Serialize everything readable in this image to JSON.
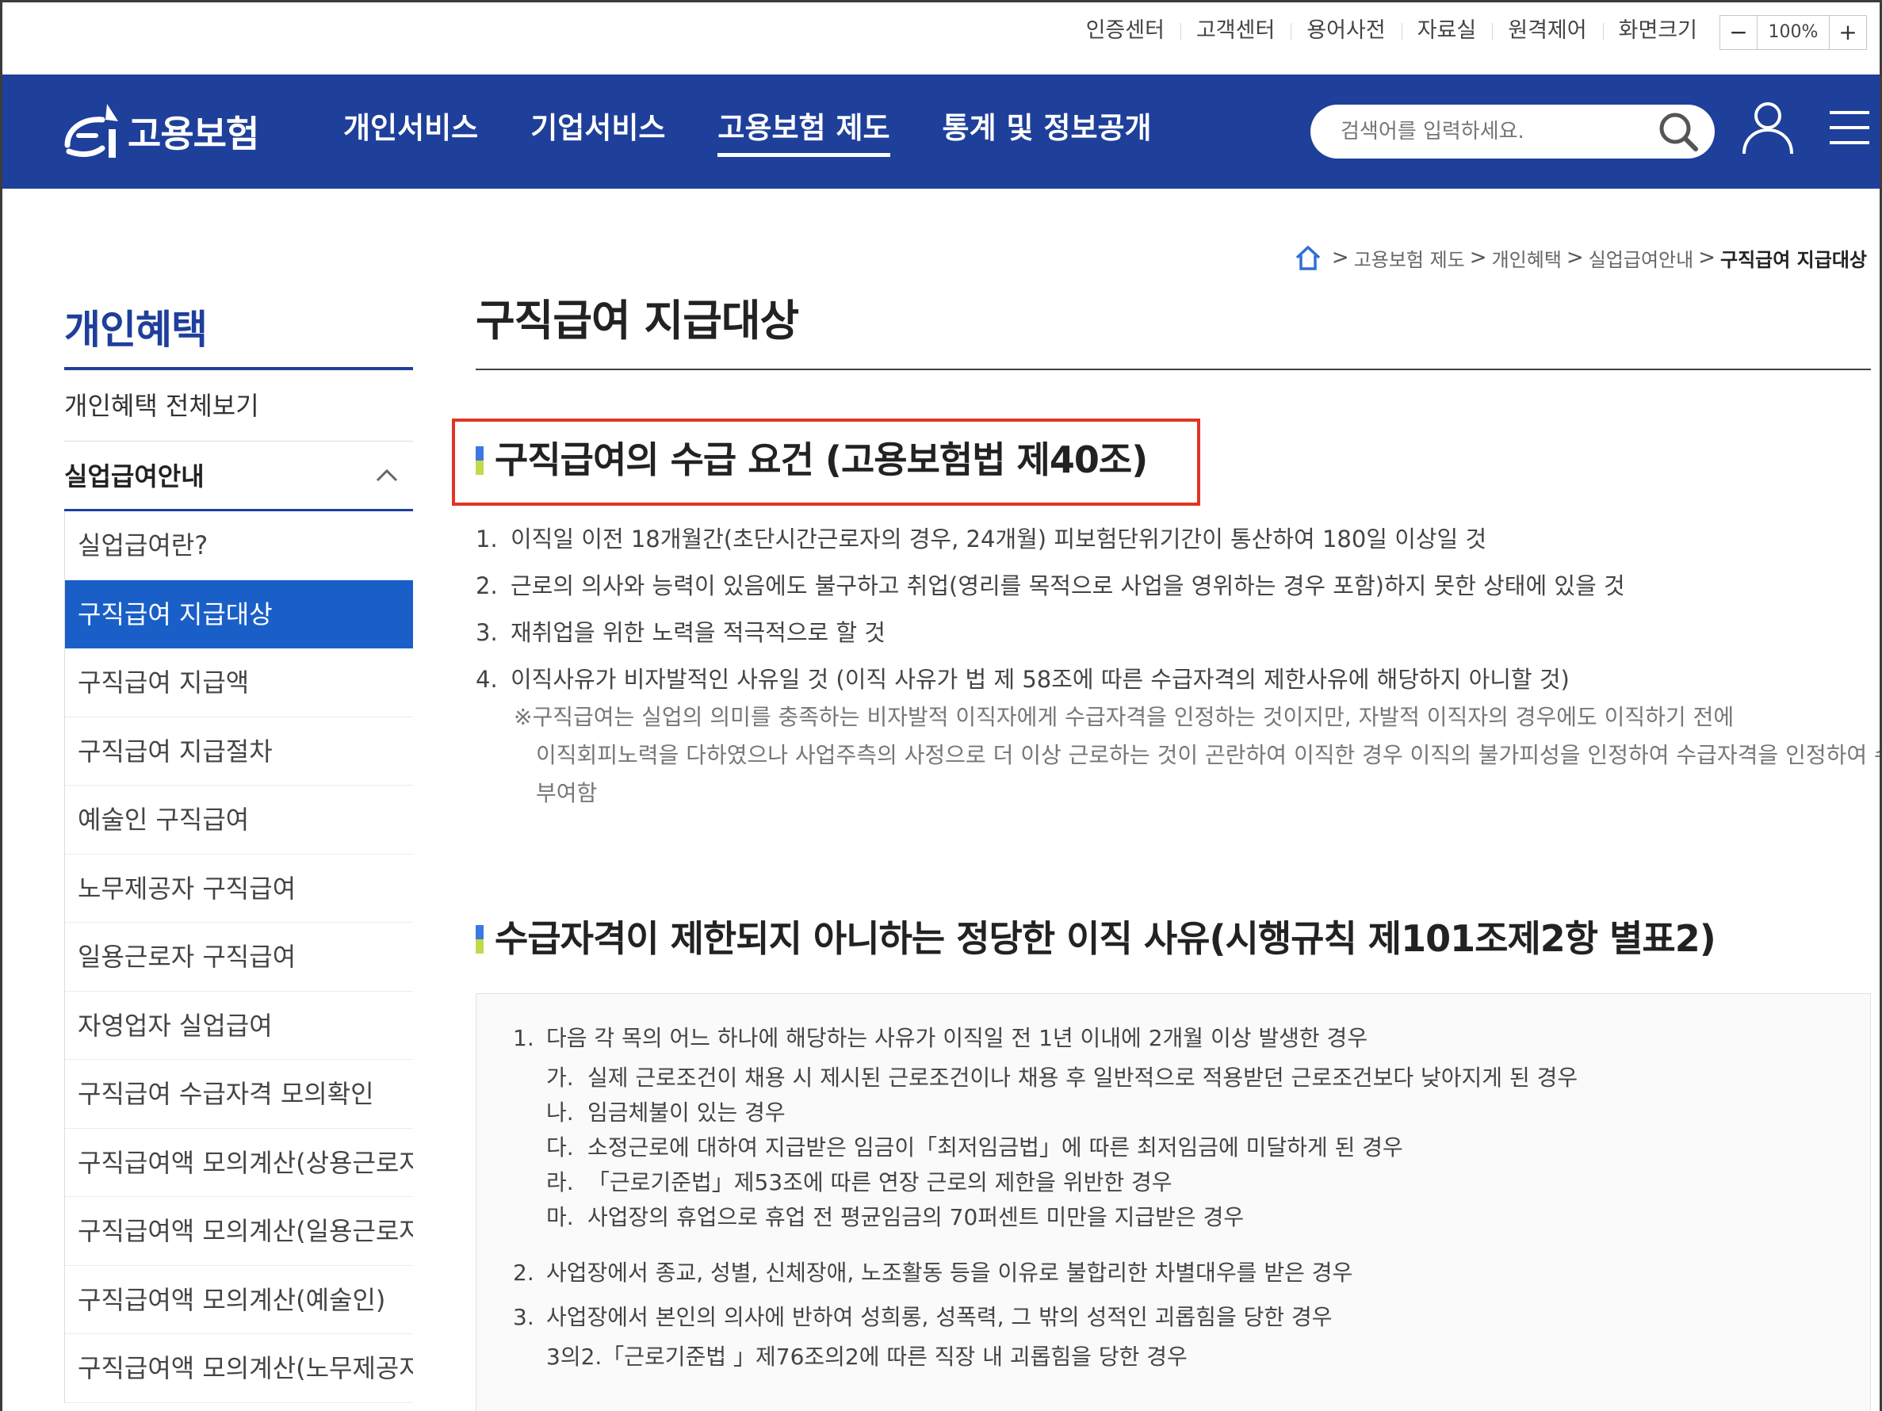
{
  "util": {
    "links": [
      "인증센터",
      "고객센터",
      "용어사전",
      "자료실",
      "원격제어",
      "화면크기"
    ],
    "zoom_minus": "−",
    "zoom_value": "100%",
    "zoom_plus": "+"
  },
  "header": {
    "logo_text": "고용보험",
    "menu": [
      "개인서비스",
      "기업서비스",
      "고용보험 제도",
      "통계 및 정보공개"
    ],
    "active_menu": "고용보험 제도",
    "search_placeholder": "검색어를 입력하세요.",
    "brand_color": "#1e3f9a"
  },
  "breadcrumb": {
    "items": [
      "고용보험 제도",
      "개인혜택",
      "실업급여안내"
    ],
    "current": "구직급여 지급대상"
  },
  "sidebar": {
    "title": "개인혜택",
    "all_link": "개인혜택 전체보기",
    "section": "실업급여안내",
    "items": [
      "실업급여란?",
      "구직급여 지급대상",
      "구직급여 지급액",
      "구직급여 지급절차",
      "예술인 구직급여",
      "노무제공자 구직급여",
      "일용근로자 구직급여",
      "자영업자 실업급여",
      "구직급여 수급자격 모의확인",
      "구직급여액 모의계산(상용근로자)",
      "구직급여액 모의계산(일용근로자)",
      "구직급여액 모의계산(예술인)",
      "구직급여액 모의계산(노무제공자)"
    ],
    "active_index": 1,
    "active_color": "#1a5fc8"
  },
  "main": {
    "title": "구직급여 지급대상",
    "section1": {
      "heading": "구직급여의 수급 요건 (고용보험법 제40조)",
      "items": [
        {
          "num": "1.",
          "text": "이직일 이전 18개월간(초단시간근로자의 경우, 24개월) 피보험단위기간이 통산하여 180일 이상일 것"
        },
        {
          "num": "2.",
          "text": "근로의 의사와 능력이 있음에도 불구하고 취업(영리를 목적으로 사업을 영위하는 경우 포함)하지 못한 상태에 있을 것"
        },
        {
          "num": "3.",
          "text": "재취업을 위한 노력을 적극적으로 할 것"
        },
        {
          "num": "4.",
          "text": "이직사유가 비자발적인 사유일 것 (이직 사유가 법 제 58조에 따른 수급자격의 제한사유에 해당하지 아니할 것)"
        }
      ],
      "note_line1": "※구직급여는 실업의 의미를 충족하는 비자발적 이직자에게 수급자격을 인정하는 것이지만, 자발적 이직자의 경우에도 이직하기 전에",
      "note_line2": "이직회피노력을 다하였으나 사업주측의 사정으로 더 이상 근로하는 것이 곤란하여 이직한 경우 이직의 불가피성을 인정하여 수급자격을 인정하여 수급자격을",
      "note_line3": "부여함"
    },
    "section2": {
      "heading": "수급자격이 제한되지 아니하는 정당한 이직 사유(시행규칙 제101조제2항 별표2)",
      "item1": {
        "num": "1.",
        "text": "다음 각 목의 어느 하나에 해당하는 사유가 이직일 전 1년 이내에 2개월 이상 발생한 경우"
      },
      "subitems": [
        {
          "num": "가.",
          "text": "실제 근로조건이 채용 시 제시된 근로조건이나 채용 후 일반적으로 적용받던 근로조건보다 낮아지게 된 경우"
        },
        {
          "num": "나.",
          "text": "임금체불이 있는 경우"
        },
        {
          "num": "다.",
          "text": "소정근로에 대하여 지급받은 임금이「최저임금법」에 따른 최저임금에 미달하게 된 경우"
        },
        {
          "num": "라.",
          "text": "「근로기준법」제53조에 따른 연장 근로의 제한을 위반한 경우"
        },
        {
          "num": "마.",
          "text": "사업장의 휴업으로 휴업 전 평균임금의 70퍼센트 미만을 지급받은 경우"
        }
      ],
      "item2": {
        "num": "2.",
        "text": "사업장에서 종교, 성별, 신체장애, 노조활동 등을 이유로 불합리한 차별대우를 받은 경우"
      },
      "item3": {
        "num": "3.",
        "text": "사업장에서 본인의 의사에 반하여 성희롱, 성폭력, 그 밖의 성적인 괴롭힘을 당한 경우"
      },
      "item3_cont": "3의2.「근로기준법 」제76조의2에 따른 직장 내 괴롭힘을 당한 경우"
    },
    "highlight_color": "#e03524"
  }
}
